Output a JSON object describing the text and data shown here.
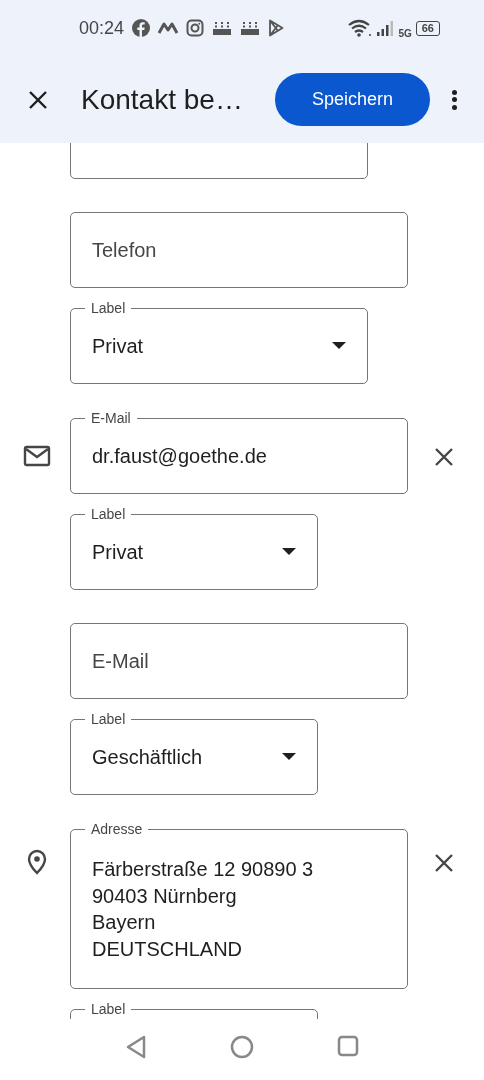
{
  "status_bar": {
    "time": "00:24",
    "network": "5G",
    "battery": "66"
  },
  "toolbar": {
    "title": "Kontakt be…",
    "save_button": "Speichern"
  },
  "sections": [
    {
      "kind": "phone",
      "fields": [
        {
          "kind": "dropdown",
          "leading_icon": false,
          "clearable": false
        },
        {
          "kind": "text",
          "placeholder": "Telefon",
          "leading_icon": false,
          "clearable": false
        },
        {
          "kind": "dropdown",
          "label": "Label",
          "value": "Privat",
          "leading_icon": false,
          "clearable": false
        }
      ]
    },
    {
      "kind": "email",
      "fields": [
        {
          "kind": "text",
          "label": "E-Mail",
          "value": "dr.faust@goethe.de",
          "leading_icon": true,
          "clearable": true
        },
        {
          "kind": "dropdown",
          "label": "Label",
          "value": "Privat",
          "leading_icon": false,
          "clearable": false
        },
        {
          "kind": "text",
          "placeholder": "E-Mail",
          "leading_icon": false,
          "clearable": false
        },
        {
          "kind": "dropdown",
          "label": "Label",
          "value": "Geschäftlich",
          "leading_icon": false,
          "clearable": false
        }
      ]
    },
    {
      "kind": "address",
      "fields": [
        {
          "kind": "multiline",
          "label": "Adresse",
          "value": "Färberstraße 12 90890 3\n90403 Nürnberg\nBayern\nDEUTSCHLAND",
          "leading_icon": true,
          "clearable": true
        },
        {
          "kind": "dropdown",
          "label": "Label",
          "leading_icon": false,
          "clearable": false
        }
      ]
    }
  ]
}
